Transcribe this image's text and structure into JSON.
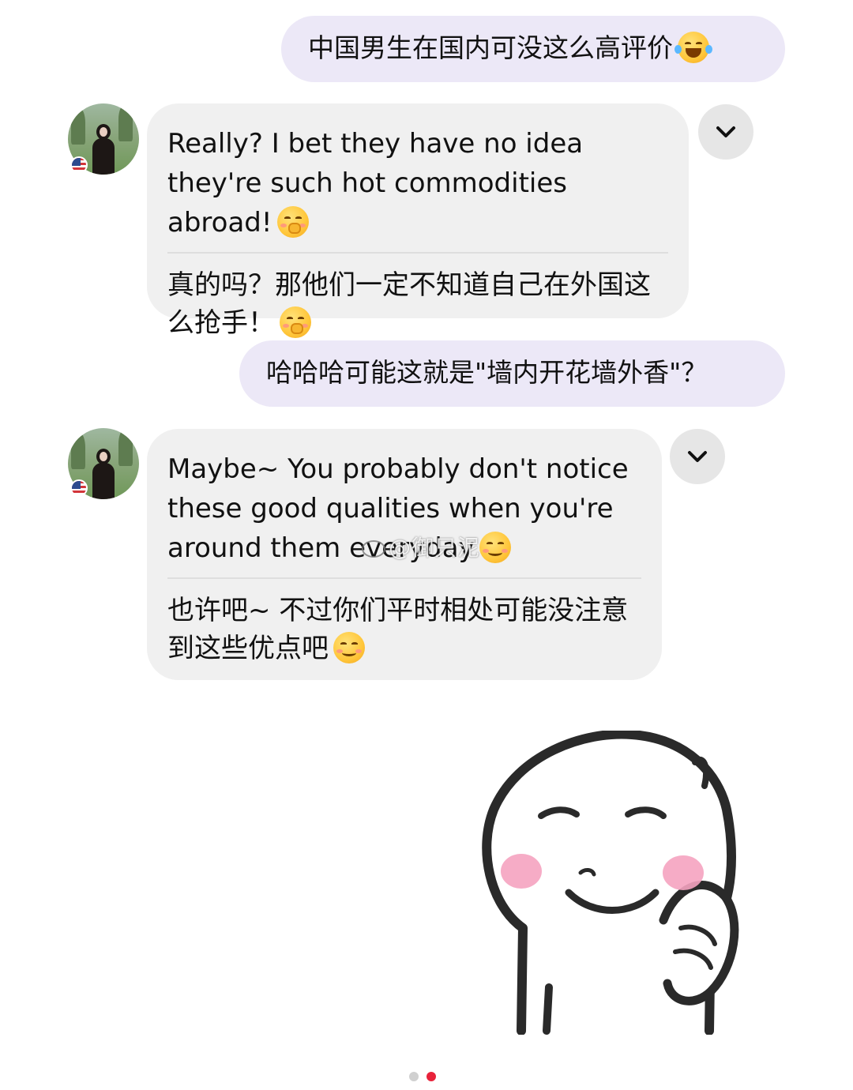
{
  "messages": [
    {
      "from": "me",
      "text": "中国男生在国内可没这么高评价",
      "emoji": "tears-of-joy-emoji"
    },
    {
      "from": "them",
      "en": "Really? I bet they have no idea they're such hot commodities abroad!",
      "zh": "真的吗？那他们一定不知道自己在外国这么抢手！",
      "emoji": "hand-over-mouth-emoji"
    },
    {
      "from": "me",
      "text": "哈哈哈可能这就是\"墙内开花墙外香\"？"
    },
    {
      "from": "them",
      "en": "Maybe~ You probably don't notice these good qualities when you're around them everyday",
      "zh": "也许吧~ 不过你们平时相处可能没注意到这些优点吧",
      "emoji": "smiling-face-emoji"
    }
  ],
  "watermark": "@御只泥",
  "sticker": "blushing-meme-face-sticker",
  "pagination": {
    "pages": 2,
    "current": 2
  },
  "colors": {
    "outgoing_bubble": "#ece8f7",
    "incoming_bubble": "#f0f0f0",
    "chevron_button": "#e6e6e6",
    "dot_active": "#e8223a",
    "dot_inactive": "#d0d0d0",
    "sticker_blush": "#f5a3c0"
  }
}
